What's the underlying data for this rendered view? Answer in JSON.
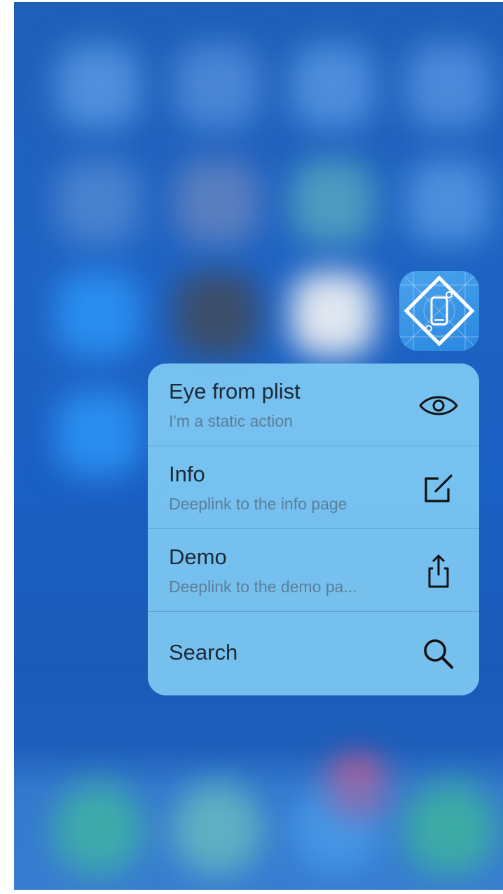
{
  "home_screen": {
    "background_color": "#1e63c3",
    "app_icon": {
      "icon": "phone-diamond-app-icon",
      "color": "#3a98e8"
    }
  },
  "quick_actions": {
    "items": [
      {
        "title": "Eye from plist",
        "subtitle": "I'm a static action",
        "icon": "eye-icon"
      },
      {
        "title": "Info",
        "subtitle": "Deeplink to the info page",
        "icon": "compose-icon"
      },
      {
        "title": "Demo",
        "subtitle": "Deeplink to the demo pa...",
        "icon": "share-icon"
      },
      {
        "title": "Search",
        "subtitle": "",
        "icon": "search-icon"
      }
    ]
  }
}
